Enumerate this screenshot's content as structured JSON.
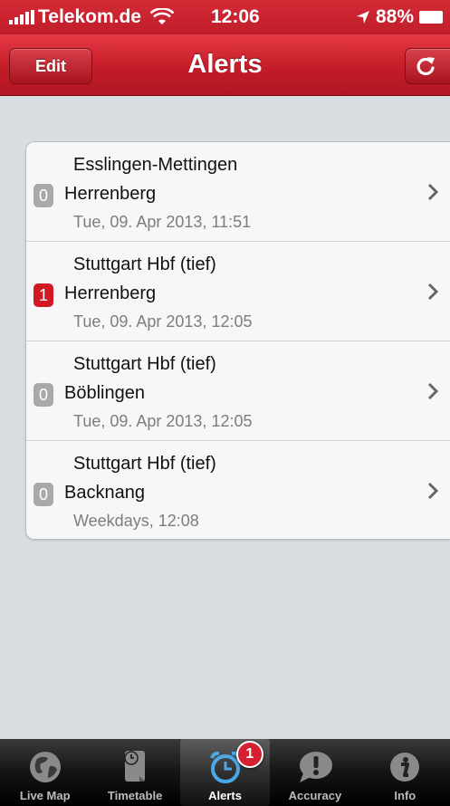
{
  "status_bar": {
    "carrier": "Telekom.de",
    "time": "12:06",
    "battery": "88%"
  },
  "nav": {
    "title": "Alerts",
    "edit_label": "Edit"
  },
  "alerts": [
    {
      "count": "0",
      "from": "Esslingen-Mettingen",
      "to": "Herrenberg",
      "when": "Tue, 09. Apr 2013, 11:51"
    },
    {
      "count": "1",
      "from": "Stuttgart Hbf (tief)",
      "to": "Herrenberg",
      "when": "Tue, 09. Apr 2013, 12:05"
    },
    {
      "count": "0",
      "from": "Stuttgart Hbf (tief)",
      "to": "Böblingen",
      "when": "Tue, 09. Apr 2013, 12:05"
    },
    {
      "count": "0",
      "from": "Stuttgart Hbf (tief)",
      "to": "Backnang",
      "when": "Weekdays, 12:08"
    }
  ],
  "tabs": [
    {
      "label": "Live Map",
      "icon": "globe-icon"
    },
    {
      "label": "Timetable",
      "icon": "timetable-icon"
    },
    {
      "label": "Alerts",
      "icon": "alarm-clock-icon",
      "badge": "1"
    },
    {
      "label": "Accuracy",
      "icon": "exclamation-bubble-icon"
    },
    {
      "label": "Info",
      "icon": "info-icon"
    }
  ],
  "colors": {
    "brand_red": "#c41c28",
    "badge_active": "#d21a24",
    "badge_zero": "#a9a9a9",
    "selected_tab_icon": "#4aa8e8"
  }
}
